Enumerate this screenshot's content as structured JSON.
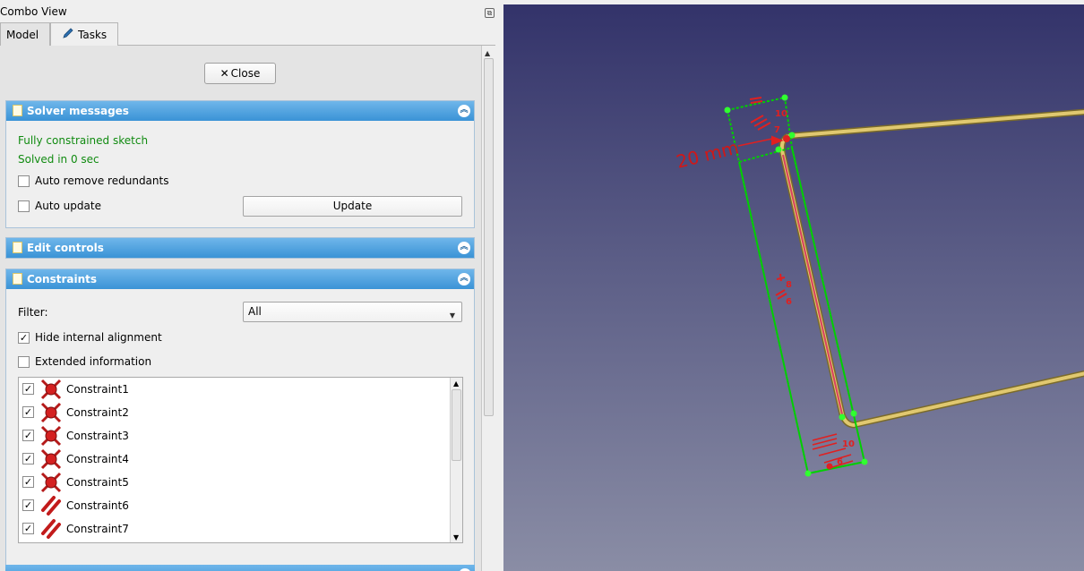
{
  "window": {
    "title": "Combo View"
  },
  "tabs": [
    {
      "label": "Model",
      "active": false
    },
    {
      "label": "Tasks",
      "active": true
    }
  ],
  "close_button": {
    "label": "Close"
  },
  "solver": {
    "title": "Solver messages",
    "status": "Fully constrained sketch",
    "time": "Solved in 0 sec",
    "auto_remove_redundants": {
      "label": "Auto remove redundants",
      "checked": false
    },
    "auto_update": {
      "label": "Auto update",
      "checked": false
    },
    "update_button": "Update"
  },
  "edit_controls": {
    "title": "Edit controls"
  },
  "constraints": {
    "title": "Constraints",
    "filter_label": "Filter:",
    "filter_value": "All",
    "hide_internal": {
      "label": "Hide internal alignment",
      "checked": true
    },
    "extended_info": {
      "label": "Extended information",
      "checked": false
    },
    "items": [
      {
        "name": "Constraint1",
        "icon": "coincident-icon",
        "checked": true
      },
      {
        "name": "Constraint2",
        "icon": "coincident-icon",
        "checked": true
      },
      {
        "name": "Constraint3",
        "icon": "coincident-icon",
        "checked": true
      },
      {
        "name": "Constraint4",
        "icon": "coincident-icon",
        "checked": true
      },
      {
        "name": "Constraint5",
        "icon": "coincident-icon",
        "checked": true
      },
      {
        "name": "Constraint6",
        "icon": "parallel-icon",
        "checked": true
      },
      {
        "name": "Constraint7",
        "icon": "parallel-icon",
        "checked": true
      }
    ]
  },
  "viewport": {
    "dimension_label": "20 mm",
    "labels": [
      "10",
      "7",
      "8",
      "6",
      "10",
      "6"
    ],
    "colors": {
      "sketch_green": "#00d000",
      "edge_yellow": "#d8c060",
      "constraint_red": "#e02020"
    }
  }
}
